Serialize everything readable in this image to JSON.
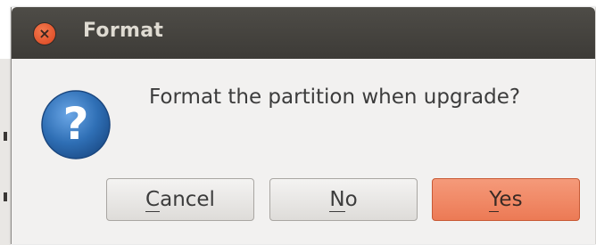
{
  "window": {
    "title": "Format",
    "close_glyph": "×",
    "close_icon": "close-icon"
  },
  "dialog": {
    "icon": "question-icon",
    "icon_glyph": "?",
    "message": "Format the partition when upgrade?"
  },
  "buttons": [
    {
      "label": "Cancel",
      "mnemonic": "C",
      "rest": "ancel",
      "default": false
    },
    {
      "label": "No",
      "mnemonic": "N",
      "rest": "o",
      "default": false
    },
    {
      "label": "Yes",
      "mnemonic": "Y",
      "rest": "es",
      "default": true
    }
  ],
  "colors": {
    "titlebar": "#3d3b37",
    "close_button": "#e0532b",
    "default_button": "#ef8560",
    "icon_blue": "#2f6fb5",
    "dialog_bg": "#f2f1f0"
  }
}
